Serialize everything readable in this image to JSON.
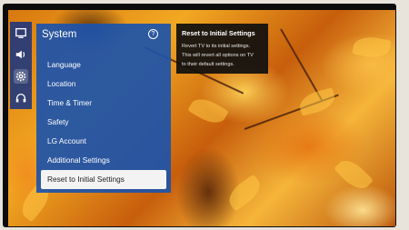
{
  "rail": {
    "icons": [
      "picture-icon",
      "sound-icon",
      "settings-gear-icon",
      "support-headset-icon"
    ],
    "active": "settings-gear-icon"
  },
  "menu": {
    "title": "System",
    "help_glyph": "?",
    "items": [
      {
        "label": "Language"
      },
      {
        "label": "Location"
      },
      {
        "label": "Time & Timer"
      },
      {
        "label": "Safety"
      },
      {
        "label": "LG Account"
      },
      {
        "label": "Additional Settings"
      },
      {
        "label": "Reset to Initial Settings"
      }
    ],
    "selected_index": 6
  },
  "tooltip": {
    "title": "Reset to Initial Settings",
    "line1": "Revert TV to its initial settings.",
    "line2": "This will revert all options on TV",
    "line3": "to their default settings."
  },
  "colors": {
    "panel": "#1c52aa",
    "selected_bg": "#f3f3f3",
    "tooltip_bg": "#0f0f0f"
  }
}
